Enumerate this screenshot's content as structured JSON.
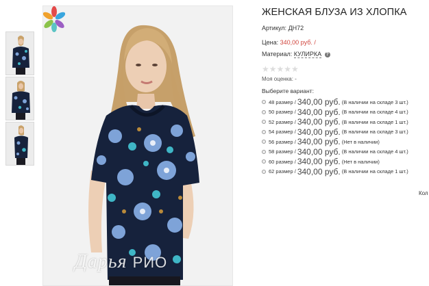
{
  "product": {
    "title": "ЖЕНСКАЯ БЛУЗА ИЗ ХЛОПКА",
    "sku_label": "Артикул:",
    "sku": "ДН72",
    "price_label": "Цена:",
    "price": "340,00 руб.",
    "price_suffix": "/",
    "material_label": "Материал:",
    "material": "КУЛИРКА",
    "help_symbol": "?",
    "stars": "★★★★★",
    "rating_max": 5,
    "rating_value": 0,
    "my_rating_label": "Моя оценка:",
    "my_rating_value": "-",
    "choose_label": "Выберите вариант:"
  },
  "variants": [
    {
      "size": "48 размер",
      "price": "340,00 руб.",
      "stock": "(В наличии на складе 3 шт.)"
    },
    {
      "size": "50 размер",
      "price": "340,00 руб.",
      "stock": "(В наличии на складе 4 шт.)"
    },
    {
      "size": "52 размер",
      "price": "340,00 руб.",
      "stock": "(В наличии на складе 1 шт.)"
    },
    {
      "size": "54 размер",
      "price": "340,00 руб.",
      "stock": "(В наличии на складе 3 шт.)"
    },
    {
      "size": "56 размер",
      "price": "340,00 руб.",
      "stock": "(Нет в наличии)"
    },
    {
      "size": "58 размер",
      "price": "340,00 руб.",
      "stock": "(В наличии на складе 4 шт.)"
    },
    {
      "size": "60 размер",
      "price": "340,00 руб.",
      "stock": "(Нет в наличии)"
    },
    {
      "size": "62 размер",
      "price": "340,00 руб.",
      "stock": "(В наличии на складе 1 шт.)"
    }
  ],
  "variant_separator": "/",
  "watermark": {
    "script": "Дарья",
    "brand": "РИО"
  },
  "cut_text": "Кол",
  "colors": {
    "price": "#d0443c",
    "fabric": "#16223c",
    "flowers": "#7ea3d8"
  }
}
